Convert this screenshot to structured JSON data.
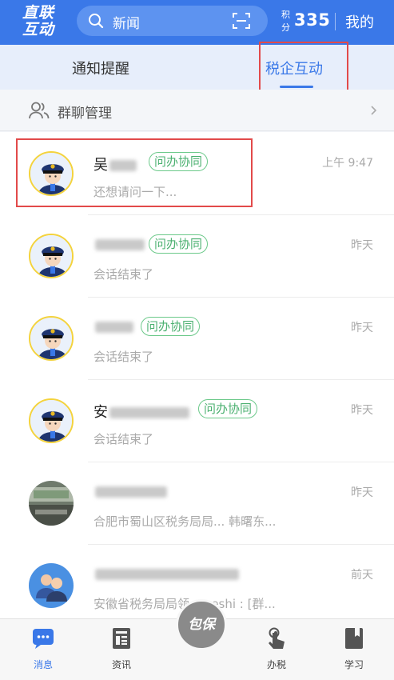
{
  "header": {
    "logo_line1": "直联",
    "logo_line2": "互动",
    "search_text": "新闻",
    "points_label": "积分",
    "points_value": "335",
    "mine_label": "我的"
  },
  "tabs": [
    {
      "label": "通知提醒",
      "active": false
    },
    {
      "label": "税企互动",
      "active": true
    }
  ],
  "group": {
    "label": "群聊管理"
  },
  "conversations": [
    {
      "name": "吴",
      "badge": "问办协同",
      "time": "上午 9:47",
      "preview": "还想请问一下..."
    },
    {
      "name": "",
      "badge": "问办协同",
      "time": "昨天",
      "preview": "会话结束了"
    },
    {
      "name": "",
      "badge": "问办协同",
      "time": "昨天",
      "preview": "会话结束了"
    },
    {
      "name": "安",
      "badge": "问办协同",
      "time": "昨天",
      "preview": "会话结束了"
    },
    {
      "name": "",
      "badge": "",
      "time": "昨天",
      "preview": "合肥市蜀山区税务局局... 韩曙东..."
    },
    {
      "name": "",
      "badge": "",
      "time": "前天",
      "preview": "安徽省税务局局领... ceshi : [群..."
    }
  ],
  "bottom_nav": [
    {
      "label": "消息",
      "icon": "message-icon",
      "active": true
    },
    {
      "label": "资讯",
      "icon": "news-icon",
      "active": false
    },
    {
      "label": "包保",
      "icon": "baobao-center-button",
      "active": false
    },
    {
      "label": "办税",
      "icon": "hand-tap-icon",
      "active": false
    },
    {
      "label": "学习",
      "icon": "book-icon",
      "active": false
    }
  ],
  "colors": {
    "primary": "#3a78e8",
    "badge_green": "#4bb070",
    "highlight_red": "#e24a4a"
  }
}
